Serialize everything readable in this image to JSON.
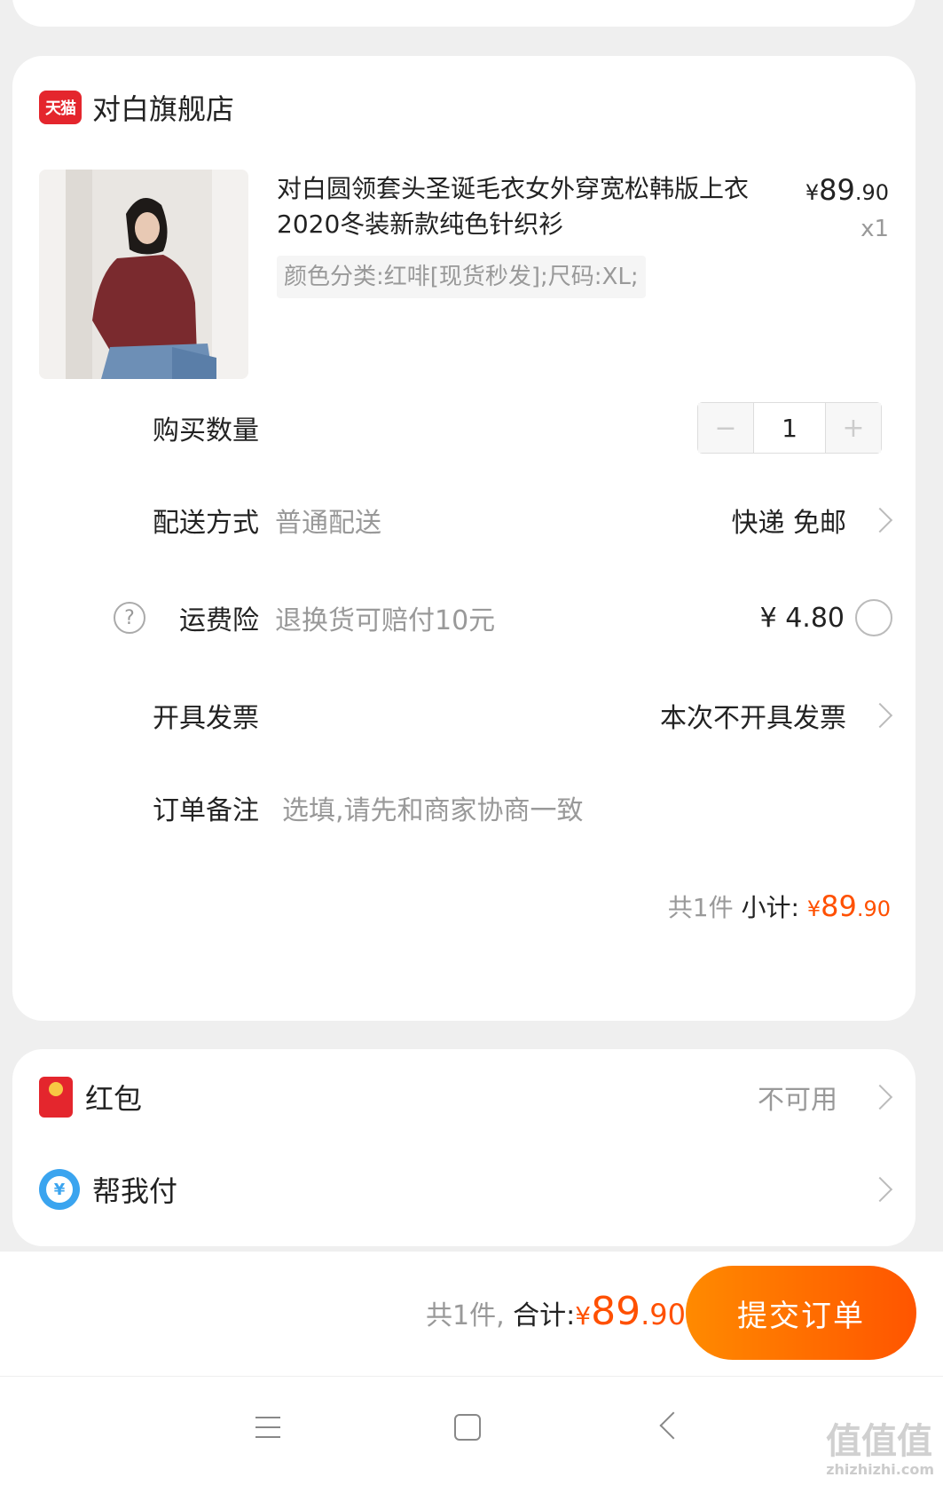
{
  "shop": {
    "badge": "天猫",
    "name": "对白旗舰店"
  },
  "product": {
    "title": "对白圆领套头圣诞毛衣女外穿宽松韩版上衣2020冬装新款纯色针织衫",
    "sku": "颜色分类:红啡[现货秒发];尺码:XL;",
    "price_symbol": "¥",
    "price_int": "89",
    "price_dec": ".90",
    "qty": "x1"
  },
  "quantity": {
    "label": "购买数量",
    "minus": "−",
    "value": "1",
    "plus": "+"
  },
  "delivery": {
    "label": "配送方式",
    "sub": "普通配送",
    "value": "快递 免邮"
  },
  "insurance": {
    "help_icon": "?",
    "label": "运费险",
    "sub": "退换货可赔付10元",
    "price": "¥ 4.80"
  },
  "invoice": {
    "label": "开具发票",
    "value": "本次不开具发票"
  },
  "note": {
    "label": "订单备注",
    "placeholder": "选填,请先和商家协商一致"
  },
  "subtotal": {
    "count": "共1件",
    "label": "小计:",
    "symbol": "¥",
    "int": "89",
    "dec": ".90"
  },
  "payments": {
    "hongbao_label": "红包",
    "hongbao_value": "不可用",
    "help_pay_label": "帮我付",
    "help_pay_icon": "¥"
  },
  "bottom": {
    "count": "共1件,",
    "label": "合计:",
    "symbol": "¥",
    "int": "89",
    "dec": ".90",
    "submit": "提交订单"
  },
  "watermark": {
    "main": "值值值",
    "sub": "zhizhizhi.com"
  },
  "colors": {
    "accent": "#ff5000",
    "tmall_red": "#e4262d",
    "help_pay_blue": "#3aa4ef"
  }
}
